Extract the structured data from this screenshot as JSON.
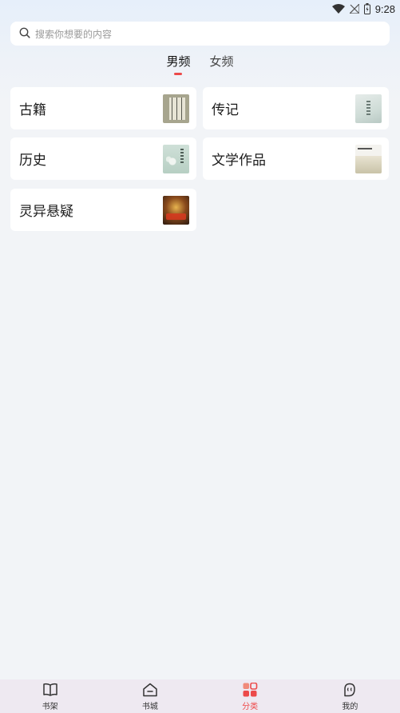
{
  "status_bar": {
    "time": "9:28",
    "icons": [
      "wifi-icon",
      "no-signal-icon",
      "battery-icon"
    ]
  },
  "search": {
    "placeholder": "搜索你想要的内容",
    "icon": "search-icon"
  },
  "tabs": [
    {
      "label": "男频",
      "active": true
    },
    {
      "label": "女频",
      "active": false
    }
  ],
  "categories": [
    {
      "label": "古籍"
    },
    {
      "label": "传记"
    },
    {
      "label": "历史"
    },
    {
      "label": "文学作品"
    },
    {
      "label": "灵异悬疑"
    }
  ],
  "bottom_nav": [
    {
      "label": "书架",
      "icon": "book-open-icon",
      "active": false
    },
    {
      "label": "书城",
      "icon": "store-icon",
      "active": false
    },
    {
      "label": "分类",
      "icon": "category-grid-icon",
      "active": true
    },
    {
      "label": "我的",
      "icon": "profile-icon",
      "active": false
    }
  ],
  "colors": {
    "accent": "#ec4a4a",
    "background": "#f2f4f7",
    "card": "#ffffff",
    "bottom_nav_bg": "#eee9f1"
  }
}
